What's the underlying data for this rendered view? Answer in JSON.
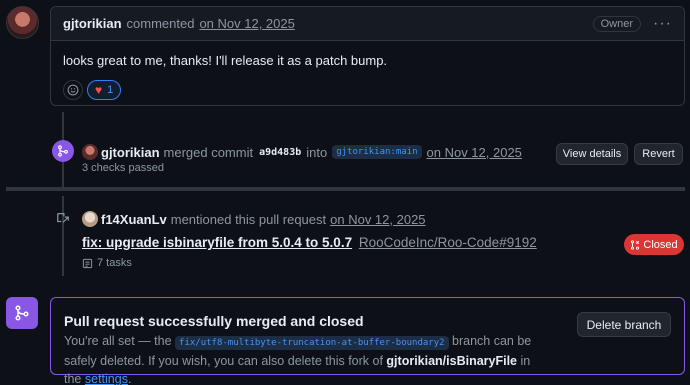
{
  "comment": {
    "author": "gjtorikian",
    "verb": "commented",
    "date": "on Nov 12, 2025",
    "badge": "Owner",
    "more_glyph": "···",
    "body": "looks great to me, thanks! I'll release it as a patch bump.",
    "reaction_add_icon": "smiley-icon",
    "reaction_heart_glyph": "♥",
    "reaction_heart_count": "1"
  },
  "merge_event": {
    "author": "gjtorikian",
    "verb": "merged commit",
    "sha": "a9d483b",
    "into": "into",
    "branch": "gjtorikian:main",
    "date": "on Nov 12, 2025",
    "checks": "3 checks passed",
    "view_details": "View details",
    "revert": "Revert"
  },
  "mention_event": {
    "author": "f14XuanLv",
    "verb": "mentioned this pull request",
    "date": "on Nov 12, 2025",
    "pr_title": "fix: upgrade isbinaryfile from 5.0.4 to 5.0.7",
    "pr_ref": "RooCodeInc/Roo-Code#9192",
    "tasks": "7 tasks",
    "status": "Closed"
  },
  "merged_box": {
    "title": "Pull request successfully merged and closed",
    "desc_prefix": "You're all set — the",
    "branch": "fix/utf8-multibyte-truncation-at-buffer-boundary2",
    "desc_mid": "branch can be safely deleted. If you wish, you can also delete this fork of",
    "fork": "gjtorikian/isBinaryFile",
    "desc_in": "in the",
    "settings": "settings",
    "period": ".",
    "delete_branch": "Delete branch"
  },
  "colors": {
    "background": "#0d1117",
    "merged_purple": "#8957e5",
    "closed_red": "#da3633",
    "link_blue": "#4493f8"
  }
}
